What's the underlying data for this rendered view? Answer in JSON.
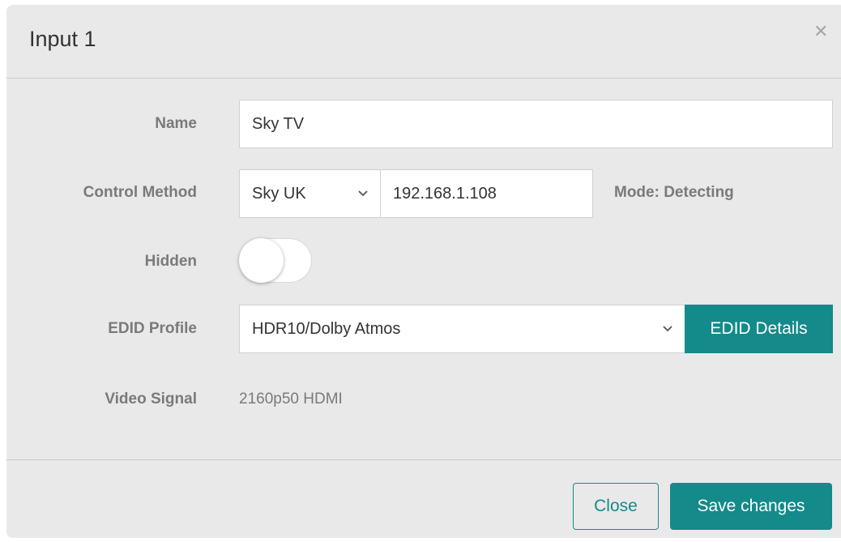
{
  "modal": {
    "title": "Input 1",
    "close_icon": "close-icon"
  },
  "form": {
    "name": {
      "label": "Name",
      "value": "Sky TV"
    },
    "control_method": {
      "label": "Control Method",
      "selected": "Sky UK",
      "ip_value": "192.168.1.108",
      "mode_text": "Mode: Detecting"
    },
    "hidden": {
      "label": "Hidden",
      "on": false
    },
    "edid_profile": {
      "label": "EDID Profile",
      "selected": "HDR10/Dolby Atmos",
      "details_button": "EDID Details"
    },
    "video_signal": {
      "label": "Video Signal",
      "value": "2160p50 HDMI"
    }
  },
  "footer": {
    "close_label": "Close",
    "save_label": "Save changes"
  },
  "colors": {
    "accent": "#148a8a",
    "modal_bg": "#e9e9e9",
    "label": "#7a7a7a"
  }
}
